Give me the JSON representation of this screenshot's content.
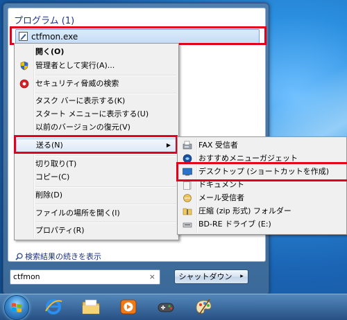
{
  "start_menu": {
    "programs_header": "プログラム (1)",
    "program_item": "ctfmon.exe",
    "search_more": "検索結果の続きを表示",
    "search_value": "ctfmon",
    "clear_symbol": "×",
    "shutdown_label": "シャットダウン",
    "shutdown_arrow": "▸"
  },
  "context_menu": {
    "items": [
      {
        "label": "開く(O)"
      },
      {
        "label": "管理者として実行(A)..."
      },
      {
        "label": "セキュリティ脅威の検索"
      },
      {
        "label": "タスク バーに表示する(K)"
      },
      {
        "label": "スタート メニューに表示する(U)"
      },
      {
        "label": "以前のバージョンの復元(V)"
      },
      {
        "label": "送る(N)"
      },
      {
        "label": "切り取り(T)"
      },
      {
        "label": "コピー(C)"
      },
      {
        "label": "削除(D)"
      },
      {
        "label": "ファイルの場所を開く(I)"
      },
      {
        "label": "プロパティ(R)"
      }
    ],
    "submenu_arrow": "▶"
  },
  "sendto_menu": {
    "items": [
      {
        "label": "FAX 受信者"
      },
      {
        "label": "おすすめメニューガジェット"
      },
      {
        "label": "デスクトップ (ショートカットを作成)"
      },
      {
        "label": "ドキュメント"
      },
      {
        "label": "メール受信者"
      },
      {
        "label": "圧縮 (zip 形式) フォルダー"
      },
      {
        "label": "BD-RE ドライブ (E:)"
      }
    ]
  },
  "colors": {
    "highlight_box": "#e3001b",
    "header_text": "#1e3287"
  }
}
